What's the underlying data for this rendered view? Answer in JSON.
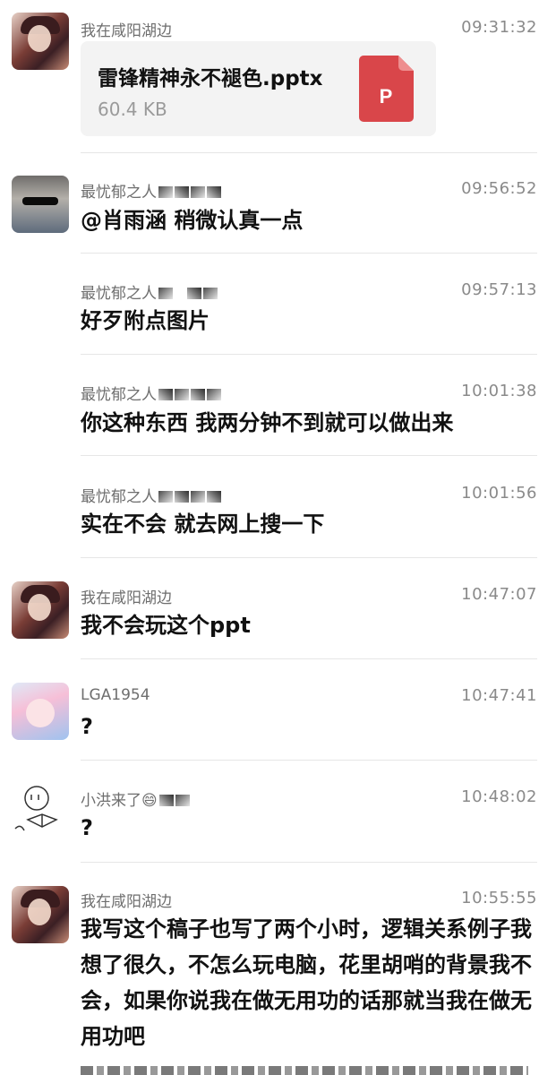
{
  "messages": [
    {
      "sender": "我在咸阳湖边",
      "time": "09:31:32",
      "file": {
        "name": "雷锋精神永不褪色.pptx",
        "size": "60.4 KB",
        "icon_letter": "P",
        "icon_color": "#d9464a"
      }
    },
    {
      "sender": "最忧郁之人",
      "time": "09:56:52",
      "text": "@肖雨涵 稍微认真一点"
    },
    {
      "sender": "最忧郁之人",
      "time": "09:57:13",
      "text": "好歹附点图片"
    },
    {
      "sender": "最忧郁之人",
      "time": "10:01:38",
      "text": "你这种东西 我两分钟不到就可以做出来"
    },
    {
      "sender": "最忧郁之人",
      "time": "10:01:56",
      "text": "实在不会 就去网上搜一下"
    },
    {
      "sender": "我在咸阳湖边",
      "time": "10:47:07",
      "text": "我不会玩这个ppt"
    },
    {
      "sender": "LGA1954",
      "time": "10:47:41",
      "text": "?"
    },
    {
      "sender": "小洪来了😄",
      "time": "10:48:02",
      "text": "?"
    },
    {
      "sender": "我在咸阳湖边",
      "time": "10:55:55",
      "text": "我写这个稿子也写了两个小时，逻辑关系例子我想了很久，不怎么玩电脑，花里胡哨的背景我不会，如果你说我在做无用功的话那就当我在做无用功吧"
    }
  ]
}
